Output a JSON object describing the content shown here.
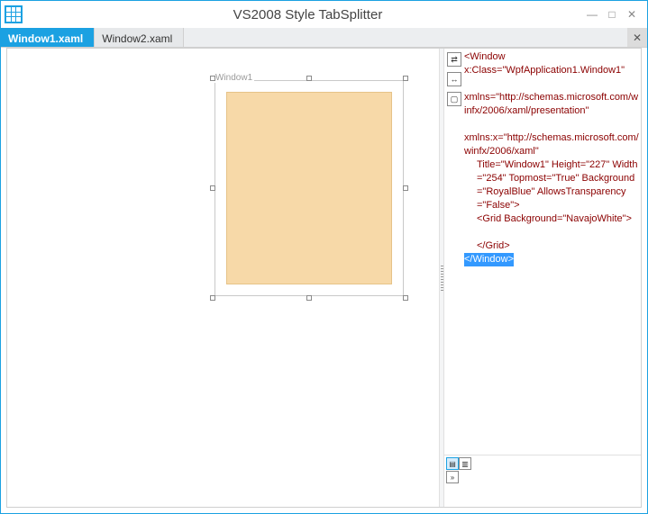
{
  "window": {
    "title": "VS2008 Style TabSplitter",
    "controls": {
      "minimize": "—",
      "maximize": "□",
      "close": "✕"
    }
  },
  "tabs": {
    "items": [
      {
        "label": "Window1.xaml",
        "active": true
      },
      {
        "label": "Window2.xaml",
        "active": false
      }
    ],
    "close_glyph": "✕"
  },
  "designer": {
    "label": "Window1",
    "content_background": "#f7d9a8"
  },
  "icons": {
    "swap": "⇄",
    "arrows": "↔",
    "box": "▢",
    "split_v": "▤",
    "split_h": "▥",
    "expand": "»"
  },
  "code": {
    "lines": [
      {
        "t": "tag_open",
        "text": "<Window"
      },
      {
        "t": "attr_line",
        "text": "x:Class=\"WpfApplication1.Window1\""
      },
      {
        "t": "blank",
        "text": ""
      },
      {
        "t": "attr_line",
        "text": "xmlns=\"http://schemas.microsoft.com/winfx/2006/xaml/presentation\""
      },
      {
        "t": "blank",
        "text": ""
      },
      {
        "t": "attr_line",
        "text": "xmlns:x=\"http://schemas.microsoft.com/winfx/2006/xaml\""
      },
      {
        "t": "attr_indent",
        "text": "Title=\"Window1\" Height=\"227\" Width=\"254\" Topmost=\"True\" Background=\"RoyalBlue\" AllowsTransparency=\"False\">"
      },
      {
        "t": "child_open",
        "text": "<Grid Background=\"NavajoWhite\">"
      },
      {
        "t": "blank",
        "text": ""
      },
      {
        "t": "child_close",
        "text": "</Grid>"
      },
      {
        "t": "tag_close_hl",
        "text": "</Window>"
      }
    ]
  }
}
